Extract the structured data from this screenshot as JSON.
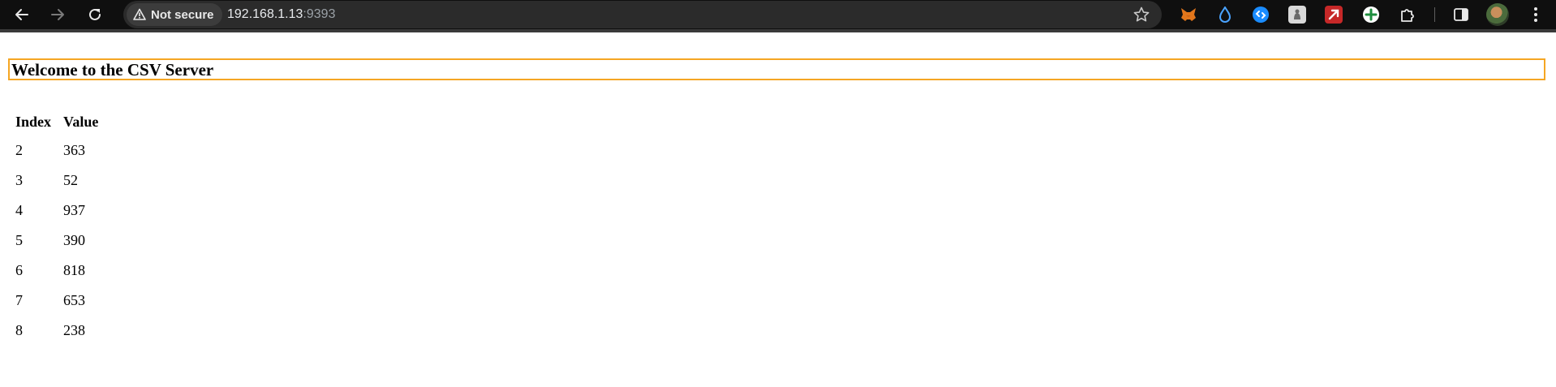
{
  "browser": {
    "security_label": "Not secure",
    "url_host": "192.168.1.13",
    "url_port": ":9393",
    "extensions": [
      "metamask-icon",
      "raindrop-icon",
      "shazam-icon",
      "extension-gray-icon",
      "arrow-red-icon",
      "add-green-icon",
      "puzzle-icon"
    ],
    "colors": {
      "toolbar": "#0f0f0f",
      "omnibox": "#2b2b2b",
      "accent": "#f5a623"
    }
  },
  "page": {
    "title": "Welcome to the CSV Server",
    "table": {
      "headers": [
        "Index",
        "Value"
      ],
      "rows": [
        [
          "2",
          "363"
        ],
        [
          "3",
          "52"
        ],
        [
          "4",
          "937"
        ],
        [
          "5",
          "390"
        ],
        [
          "6",
          "818"
        ],
        [
          "7",
          "653"
        ],
        [
          "8",
          "238"
        ]
      ]
    }
  }
}
